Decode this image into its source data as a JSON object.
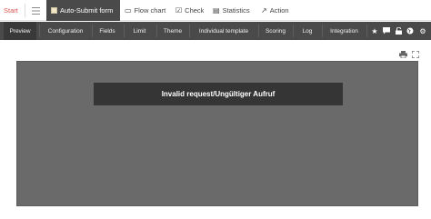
{
  "toolbar": {
    "start_label": "Start",
    "active_label": "Auto-Submit form",
    "flow_label": "Flow chart",
    "check_label": "Check",
    "stats_label": "Statistics",
    "action_label": "Action"
  },
  "nav": {
    "items": [
      {
        "label": "Preview"
      },
      {
        "label": "Configuration"
      },
      {
        "label": "Fields"
      },
      {
        "label": "Limit"
      },
      {
        "label": "Theme"
      },
      {
        "label": "Individual template"
      },
      {
        "label": "Scoring"
      },
      {
        "label": "Log"
      },
      {
        "label": "Integration"
      }
    ]
  },
  "preview": {
    "error_message": "Invalid request/Ungültiger Aufruf"
  },
  "colors": {
    "accent_red": "#d9534f",
    "dark_bar": "#4a4a4a",
    "frame_gray": "#6a6a6a",
    "error_box": "#353535"
  }
}
